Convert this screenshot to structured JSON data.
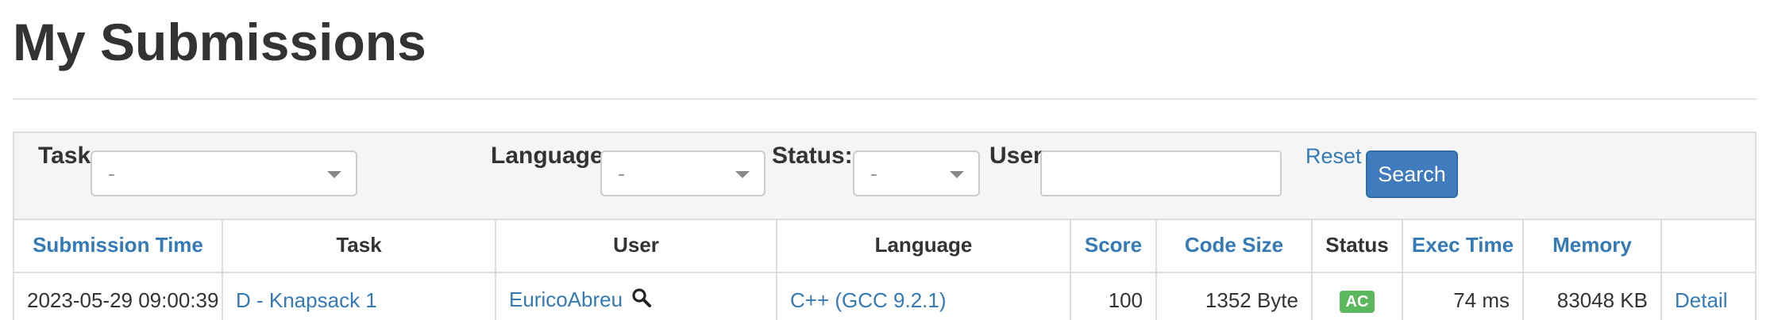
{
  "page": {
    "title": "My Submissions"
  },
  "filters": {
    "task_label": "Task:",
    "task_value": "-",
    "language_label": "Language:",
    "language_value": "-",
    "status_label": "Status:",
    "status_value": "-",
    "user_label": "User:",
    "user_value": "",
    "reset_label": "Reset",
    "search_label": "Search"
  },
  "table": {
    "headers": [
      "Submission Time",
      "Task",
      "User",
      "Language",
      "Score",
      "Code Size",
      "Status",
      "Exec Time",
      "Memory",
      ""
    ],
    "rows": [
      {
        "submission_time": "2023-05-29 09:00:39",
        "task": "D - Knapsack 1",
        "user": "EuricoAbreu",
        "language": "C++ (GCC 9.2.1)",
        "score": "100",
        "code_size": "1352 Byte",
        "status": "AC",
        "exec_time": "74 ms",
        "memory": "83048 KB",
        "detail": "Detail"
      }
    ]
  },
  "icons": {
    "select_caret": "chevron-down-icon",
    "user_search": "search-icon"
  },
  "colors": {
    "link": "#337ab7",
    "primary_button": "#3f7bbd",
    "status_ac": "#5cb85c",
    "filter_bg": "#f5f5f5"
  }
}
